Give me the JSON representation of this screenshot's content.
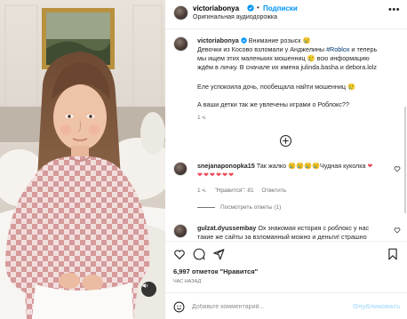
{
  "header": {
    "username": "victoriabonya",
    "separator": "•",
    "follow_label": "Подписки",
    "audio_label": "Оригинальная аудиодорожка",
    "more_icon": "more-horizontal-icon",
    "verified_color": "#0095f6"
  },
  "caption": {
    "username": "victoriabonya",
    "line1": "Внимание розыск",
    "line2_pre": "Девочки из Косово взломали у Анджелины ",
    "hashtag": "#Roblox",
    "line2_post": " и теперь",
    "line3": "мы ищем этих маленьких мошенниц 🥲 всю информацию",
    "line4_pre": "ждём в личку. В сначале их имена ",
    "names": "julinda.basha и debora.lolz",
    "line5": "Еле успокоила дочь, пообещала найти мошенниц 🥲",
    "line6": "А ваши детки так же увлечены играми о Роблокс??",
    "time": "1 ч."
  },
  "comment1": {
    "username": "snejanaponopka15",
    "text_pre": "Так жалко",
    "text_post": "Чудная куколка",
    "time": "1 ч.",
    "likes": "\"Нравится\": 81",
    "reply_label": "Ответить",
    "view_replies": "Посмотреть ответы (1)"
  },
  "comment2": {
    "username": "gulzat.dyussembay",
    "text_line1": "Ох знакомая история с роблокс у нас",
    "text_line2": "такие же сайты за взломанный можно и деньги! страшно"
  },
  "actions": {
    "likes_text": "6,997 отметок \"Нравится\"",
    "time_text": "ЧАС НАЗАД"
  },
  "comment_bar": {
    "placeholder": "Добавьте комментарий...",
    "post_label": "Опубликовать"
  },
  "colors": {
    "accent": "#0095f6",
    "like_red": "#ed4956",
    "muted": "#737373"
  }
}
